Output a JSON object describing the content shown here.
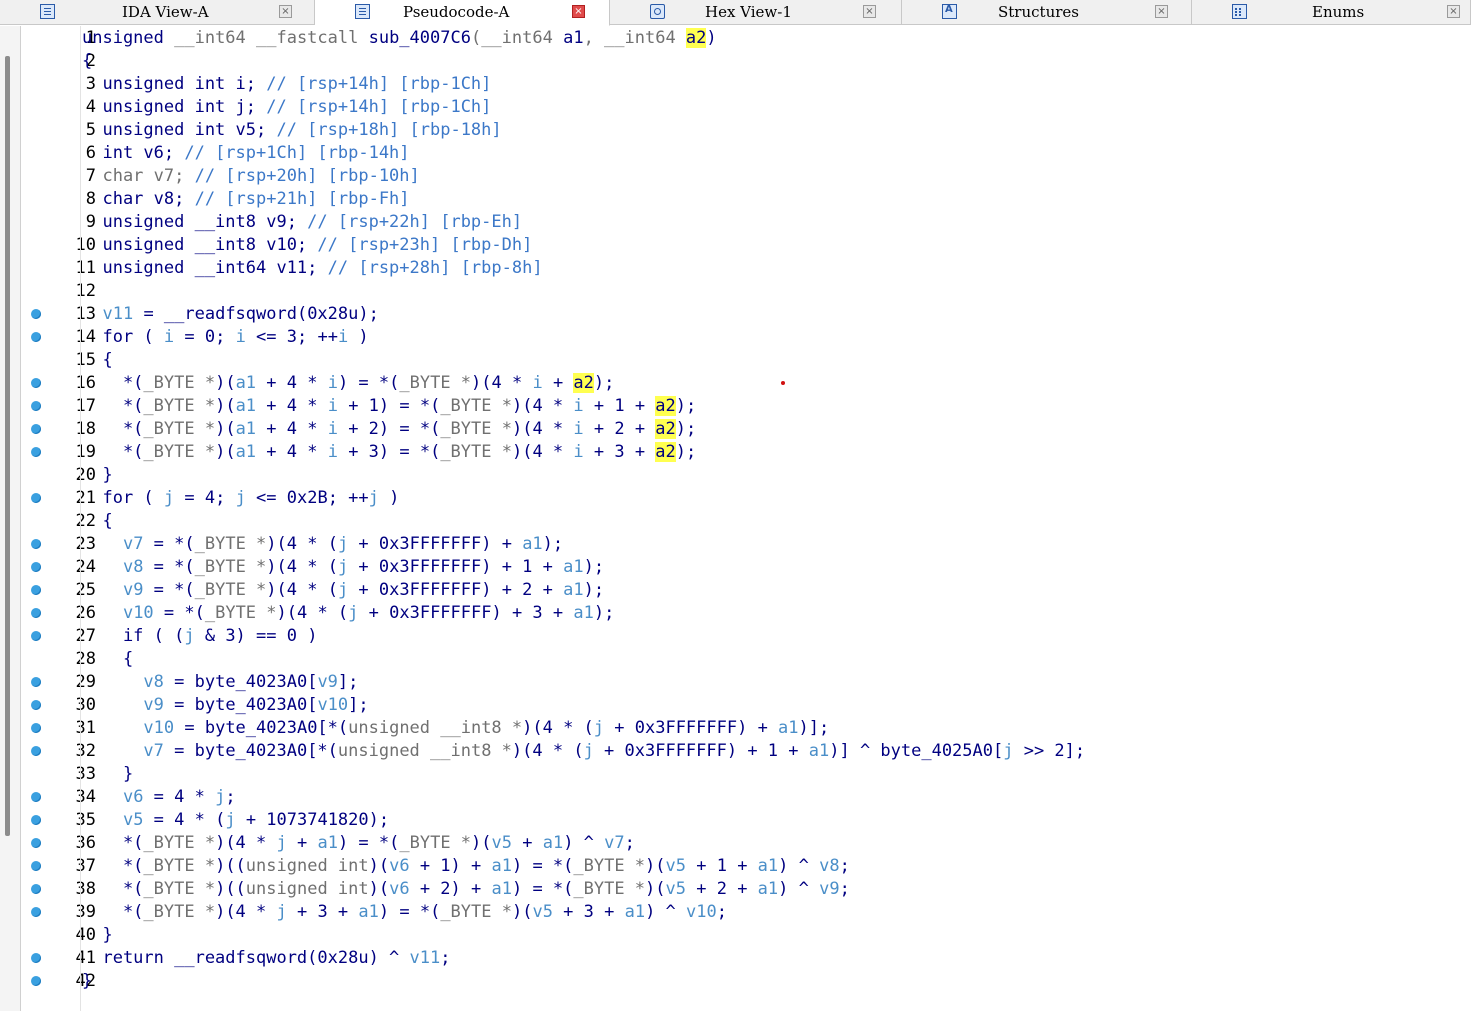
{
  "tabs": [
    {
      "label": "IDA View-A",
      "icon": "ida-view-icon",
      "active": false
    },
    {
      "label": "Pseudocode-A",
      "icon": "pseudocode-icon",
      "active": true
    },
    {
      "label": "Hex View-1",
      "icon": "hex-view-icon",
      "active": false
    },
    {
      "label": "Structures",
      "icon": "structures-icon",
      "active": false
    },
    {
      "label": "Enums",
      "icon": "enums-icon",
      "active": false
    }
  ],
  "colors": {
    "keyword": "#000080",
    "variable": "#4a8ec8",
    "comment": "#3c78c8",
    "cast": "#707070",
    "highlight": "#ffff50",
    "breakpoint": "#3aa0e0"
  },
  "highlighted_token": "a2",
  "lines": [
    {
      "n": "1",
      "bp": false,
      "segs": [
        [
          "k",
          "unsigned "
        ],
        [
          "g",
          "__int64 __fastcall "
        ],
        [
          "k",
          "sub_4007C6"
        ],
        [
          "g",
          "(__int64 "
        ],
        [
          "k",
          "a1"
        ],
        [
          "g",
          ", __int64 "
        ],
        [
          "h",
          "a2"
        ],
        [
          "k",
          ")"
        ]
      ]
    },
    {
      "n": "2",
      "bp": false,
      "segs": [
        [
          "k",
          "{"
        ]
      ]
    },
    {
      "n": "3",
      "bp": false,
      "segs": [
        [
          "k",
          "  unsigned int i; "
        ],
        [
          "c",
          "// [rsp+14h] [rbp-1Ch]"
        ]
      ]
    },
    {
      "n": "4",
      "bp": false,
      "segs": [
        [
          "k",
          "  unsigned int j; "
        ],
        [
          "c",
          "// [rsp+14h] [rbp-1Ch]"
        ]
      ]
    },
    {
      "n": "5",
      "bp": false,
      "segs": [
        [
          "k",
          "  unsigned int v5; "
        ],
        [
          "c",
          "// [rsp+18h] [rbp-18h]"
        ]
      ]
    },
    {
      "n": "6",
      "bp": false,
      "segs": [
        [
          "k",
          "  int v6; "
        ],
        [
          "c",
          "// [rsp+1Ch] [rbp-14h]"
        ]
      ]
    },
    {
      "n": "7",
      "bp": false,
      "segs": [
        [
          "g",
          "  char v7; "
        ],
        [
          "c",
          "// [rsp+20h] [rbp-10h]"
        ]
      ]
    },
    {
      "n": "8",
      "bp": false,
      "segs": [
        [
          "k",
          "  char v8; "
        ],
        [
          "c",
          "// [rsp+21h] [rbp-Fh]"
        ]
      ]
    },
    {
      "n": "9",
      "bp": false,
      "segs": [
        [
          "k",
          "  unsigned __int8 v9; "
        ],
        [
          "c",
          "// [rsp+22h] [rbp-Eh]"
        ]
      ]
    },
    {
      "n": "10",
      "bp": false,
      "segs": [
        [
          "k",
          "  unsigned __int8 v10; "
        ],
        [
          "c",
          "// [rsp+23h] [rbp-Dh]"
        ]
      ]
    },
    {
      "n": "11",
      "bp": false,
      "segs": [
        [
          "k",
          "  unsigned __int64 v11; "
        ],
        [
          "c",
          "// [rsp+28h] [rbp-8h]"
        ]
      ]
    },
    {
      "n": "12",
      "bp": false,
      "segs": [
        [
          "k",
          ""
        ]
      ]
    },
    {
      "n": "13",
      "bp": true,
      "segs": [
        [
          "k",
          "  "
        ],
        [
          "v",
          "v11"
        ],
        [
          "k",
          " = __readfsqword(0x28u);"
        ]
      ]
    },
    {
      "n": "14",
      "bp": true,
      "segs": [
        [
          "k",
          "  for ( "
        ],
        [
          "v",
          "i"
        ],
        [
          "k",
          " = 0; "
        ],
        [
          "v",
          "i"
        ],
        [
          "k",
          " <= 3; ++"
        ],
        [
          "v",
          "i"
        ],
        [
          "k",
          " )"
        ]
      ]
    },
    {
      "n": "15",
      "bp": false,
      "segs": [
        [
          "k",
          "  {"
        ]
      ]
    },
    {
      "n": "16",
      "bp": true,
      "segs": [
        [
          "k",
          "    *("
        ],
        [
          "g",
          "_BYTE *"
        ],
        [
          "k",
          ")("
        ],
        [
          "v",
          "a1"
        ],
        [
          "k",
          " + 4 * "
        ],
        [
          "v",
          "i"
        ],
        [
          "k",
          ") = *("
        ],
        [
          "g",
          "_BYTE *"
        ],
        [
          "k",
          ")(4 * "
        ],
        [
          "v",
          "i"
        ],
        [
          "k",
          " + "
        ],
        [
          "h",
          "a2"
        ],
        [
          "k",
          ");"
        ]
      ]
    },
    {
      "n": "17",
      "bp": true,
      "segs": [
        [
          "k",
          "    *("
        ],
        [
          "g",
          "_BYTE *"
        ],
        [
          "k",
          ")("
        ],
        [
          "v",
          "a1"
        ],
        [
          "k",
          " + 4 * "
        ],
        [
          "v",
          "i"
        ],
        [
          "k",
          " + 1) = *("
        ],
        [
          "g",
          "_BYTE *"
        ],
        [
          "k",
          ")(4 * "
        ],
        [
          "v",
          "i"
        ],
        [
          "k",
          " + 1 + "
        ],
        [
          "h",
          "a2"
        ],
        [
          "k",
          ");"
        ]
      ]
    },
    {
      "n": "18",
      "bp": true,
      "segs": [
        [
          "k",
          "    *("
        ],
        [
          "g",
          "_BYTE *"
        ],
        [
          "k",
          ")("
        ],
        [
          "v",
          "a1"
        ],
        [
          "k",
          " + 4 * "
        ],
        [
          "v",
          "i"
        ],
        [
          "k",
          " + 2) = *("
        ],
        [
          "g",
          "_BYTE *"
        ],
        [
          "k",
          ")(4 * "
        ],
        [
          "v",
          "i"
        ],
        [
          "k",
          " + 2 + "
        ],
        [
          "h",
          "a2"
        ],
        [
          "k",
          ");"
        ]
      ]
    },
    {
      "n": "19",
      "bp": true,
      "segs": [
        [
          "k",
          "    *("
        ],
        [
          "g",
          "_BYTE *"
        ],
        [
          "k",
          ")("
        ],
        [
          "v",
          "a1"
        ],
        [
          "k",
          " + 4 * "
        ],
        [
          "v",
          "i"
        ],
        [
          "k",
          " + 3) = *("
        ],
        [
          "g",
          "_BYTE *"
        ],
        [
          "k",
          ")(4 * "
        ],
        [
          "v",
          "i"
        ],
        [
          "k",
          " + 3 + "
        ],
        [
          "h",
          "a2"
        ],
        [
          "k",
          ");"
        ]
      ]
    },
    {
      "n": "20",
      "bp": false,
      "segs": [
        [
          "k",
          "  }"
        ]
      ]
    },
    {
      "n": "21",
      "bp": true,
      "segs": [
        [
          "k",
          "  for ( "
        ],
        [
          "v",
          "j"
        ],
        [
          "k",
          " = 4; "
        ],
        [
          "v",
          "j"
        ],
        [
          "k",
          " <= 0x2B; ++"
        ],
        [
          "v",
          "j"
        ],
        [
          "k",
          " )"
        ]
      ]
    },
    {
      "n": "22",
      "bp": false,
      "segs": [
        [
          "k",
          "  {"
        ]
      ]
    },
    {
      "n": "23",
      "bp": true,
      "segs": [
        [
          "k",
          "    "
        ],
        [
          "v",
          "v7"
        ],
        [
          "k",
          " = *("
        ],
        [
          "g",
          "_BYTE *"
        ],
        [
          "k",
          ")(4 * ("
        ],
        [
          "v",
          "j"
        ],
        [
          "k",
          " + 0x3FFFFFFF) + "
        ],
        [
          "v",
          "a1"
        ],
        [
          "k",
          ");"
        ]
      ]
    },
    {
      "n": "24",
      "bp": true,
      "segs": [
        [
          "k",
          "    "
        ],
        [
          "v",
          "v8"
        ],
        [
          "k",
          " = *("
        ],
        [
          "g",
          "_BYTE *"
        ],
        [
          "k",
          ")(4 * ("
        ],
        [
          "v",
          "j"
        ],
        [
          "k",
          " + 0x3FFFFFFF) + 1 + "
        ],
        [
          "v",
          "a1"
        ],
        [
          "k",
          ");"
        ]
      ]
    },
    {
      "n": "25",
      "bp": true,
      "segs": [
        [
          "k",
          "    "
        ],
        [
          "v",
          "v9"
        ],
        [
          "k",
          " = *("
        ],
        [
          "g",
          "_BYTE *"
        ],
        [
          "k",
          ")(4 * ("
        ],
        [
          "v",
          "j"
        ],
        [
          "k",
          " + 0x3FFFFFFF) + 2 + "
        ],
        [
          "v",
          "a1"
        ],
        [
          "k",
          ");"
        ]
      ]
    },
    {
      "n": "26",
      "bp": true,
      "segs": [
        [
          "k",
          "    "
        ],
        [
          "v",
          "v10"
        ],
        [
          "k",
          " = *("
        ],
        [
          "g",
          "_BYTE *"
        ],
        [
          "k",
          ")(4 * ("
        ],
        [
          "v",
          "j"
        ],
        [
          "k",
          " + 0x3FFFFFFF) + 3 + "
        ],
        [
          "v",
          "a1"
        ],
        [
          "k",
          ");"
        ]
      ]
    },
    {
      "n": "27",
      "bp": true,
      "segs": [
        [
          "k",
          "    if ( ("
        ],
        [
          "v",
          "j"
        ],
        [
          "k",
          " & 3) == 0 )"
        ]
      ]
    },
    {
      "n": "28",
      "bp": false,
      "segs": [
        [
          "k",
          "    {"
        ]
      ]
    },
    {
      "n": "29",
      "bp": true,
      "segs": [
        [
          "k",
          "      "
        ],
        [
          "v",
          "v8"
        ],
        [
          "k",
          " = byte_4023A0["
        ],
        [
          "v",
          "v9"
        ],
        [
          "k",
          "];"
        ]
      ]
    },
    {
      "n": "30",
      "bp": true,
      "segs": [
        [
          "k",
          "      "
        ],
        [
          "v",
          "v9"
        ],
        [
          "k",
          " = byte_4023A0["
        ],
        [
          "v",
          "v10"
        ],
        [
          "k",
          "];"
        ]
      ]
    },
    {
      "n": "31",
      "bp": true,
      "segs": [
        [
          "k",
          "      "
        ],
        [
          "v",
          "v10"
        ],
        [
          "k",
          " = byte_4023A0[*("
        ],
        [
          "g",
          "unsigned __int8 *"
        ],
        [
          "k",
          ")(4 * ("
        ],
        [
          "v",
          "j"
        ],
        [
          "k",
          " + 0x3FFFFFFF) + "
        ],
        [
          "v",
          "a1"
        ],
        [
          "k",
          ")];"
        ]
      ]
    },
    {
      "n": "32",
      "bp": true,
      "segs": [
        [
          "k",
          "      "
        ],
        [
          "v",
          "v7"
        ],
        [
          "k",
          " = byte_4023A0[*("
        ],
        [
          "g",
          "unsigned __int8 *"
        ],
        [
          "k",
          ")(4 * ("
        ],
        [
          "v",
          "j"
        ],
        [
          "k",
          " + 0x3FFFFFFF) + 1 + "
        ],
        [
          "v",
          "a1"
        ],
        [
          "k",
          ")] ^ byte_4025A0["
        ],
        [
          "v",
          "j"
        ],
        [
          "k",
          " >> 2];"
        ]
      ]
    },
    {
      "n": "33",
      "bp": false,
      "segs": [
        [
          "k",
          "    }"
        ]
      ]
    },
    {
      "n": "34",
      "bp": true,
      "segs": [
        [
          "k",
          "    "
        ],
        [
          "v",
          "v6"
        ],
        [
          "k",
          " = 4 * "
        ],
        [
          "v",
          "j"
        ],
        [
          "k",
          ";"
        ]
      ]
    },
    {
      "n": "35",
      "bp": true,
      "segs": [
        [
          "k",
          "    "
        ],
        [
          "v",
          "v5"
        ],
        [
          "k",
          " = 4 * ("
        ],
        [
          "v",
          "j"
        ],
        [
          "k",
          " + 1073741820);"
        ]
      ]
    },
    {
      "n": "36",
      "bp": true,
      "segs": [
        [
          "k",
          "    *("
        ],
        [
          "g",
          "_BYTE *"
        ],
        [
          "k",
          ")(4 * "
        ],
        [
          "v",
          "j"
        ],
        [
          "k",
          " + "
        ],
        [
          "v",
          "a1"
        ],
        [
          "k",
          ") = *("
        ],
        [
          "g",
          "_BYTE *"
        ],
        [
          "k",
          ")("
        ],
        [
          "v",
          "v5"
        ],
        [
          "k",
          " + "
        ],
        [
          "v",
          "a1"
        ],
        [
          "k",
          ") ^ "
        ],
        [
          "v",
          "v7"
        ],
        [
          "k",
          ";"
        ]
      ]
    },
    {
      "n": "37",
      "bp": true,
      "segs": [
        [
          "k",
          "    *("
        ],
        [
          "g",
          "_BYTE *"
        ],
        [
          "k",
          ")(("
        ],
        [
          "g",
          "unsigned int"
        ],
        [
          "k",
          ")("
        ],
        [
          "v",
          "v6"
        ],
        [
          "k",
          " + 1) + "
        ],
        [
          "v",
          "a1"
        ],
        [
          "k",
          ") = *("
        ],
        [
          "g",
          "_BYTE *"
        ],
        [
          "k",
          ")("
        ],
        [
          "v",
          "v5"
        ],
        [
          "k",
          " + 1 + "
        ],
        [
          "v",
          "a1"
        ],
        [
          "k",
          ") ^ "
        ],
        [
          "v",
          "v8"
        ],
        [
          "k",
          ";"
        ]
      ]
    },
    {
      "n": "38",
      "bp": true,
      "segs": [
        [
          "k",
          "    *("
        ],
        [
          "g",
          "_BYTE *"
        ],
        [
          "k",
          ")(("
        ],
        [
          "g",
          "unsigned int"
        ],
        [
          "k",
          ")("
        ],
        [
          "v",
          "v6"
        ],
        [
          "k",
          " + 2) + "
        ],
        [
          "v",
          "a1"
        ],
        [
          "k",
          ") = *("
        ],
        [
          "g",
          "_BYTE *"
        ],
        [
          "k",
          ")("
        ],
        [
          "v",
          "v5"
        ],
        [
          "k",
          " + 2 + "
        ],
        [
          "v",
          "a1"
        ],
        [
          "k",
          ") ^ "
        ],
        [
          "v",
          "v9"
        ],
        [
          "k",
          ";"
        ]
      ]
    },
    {
      "n": "39",
      "bp": true,
      "segs": [
        [
          "k",
          "    *("
        ],
        [
          "g",
          "_BYTE *"
        ],
        [
          "k",
          ")(4 * "
        ],
        [
          "v",
          "j"
        ],
        [
          "k",
          " + 3 + "
        ],
        [
          "v",
          "a1"
        ],
        [
          "k",
          ") = *("
        ],
        [
          "g",
          "_BYTE *"
        ],
        [
          "k",
          ")("
        ],
        [
          "v",
          "v5"
        ],
        [
          "k",
          " + 3 + "
        ],
        [
          "v",
          "a1"
        ],
        [
          "k",
          ") ^ "
        ],
        [
          "v",
          "v10"
        ],
        [
          "k",
          ";"
        ]
      ]
    },
    {
      "n": "40",
      "bp": false,
      "segs": [
        [
          "k",
          "  }"
        ]
      ]
    },
    {
      "n": "41",
      "bp": true,
      "segs": [
        [
          "k",
          "  return __readfsqword(0x28u) ^ "
        ],
        [
          "v",
          "v11"
        ],
        [
          "k",
          ";"
        ]
      ]
    },
    {
      "n": "42",
      "bp": true,
      "segs": [
        [
          "k",
          "}"
        ]
      ]
    }
  ]
}
